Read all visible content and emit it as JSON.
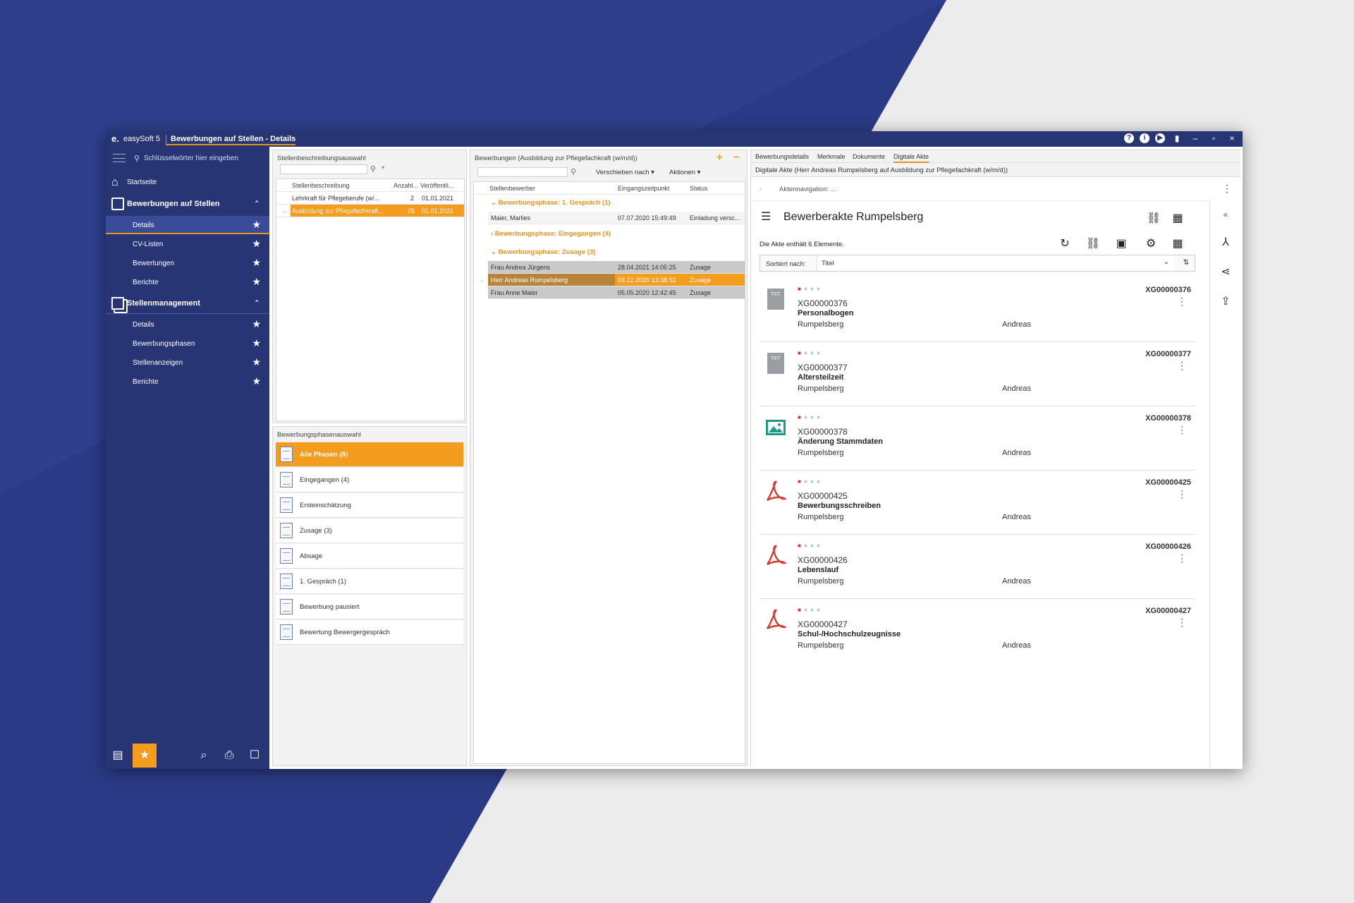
{
  "window": {
    "app_name": "easySoft 5",
    "title": "Bewerbungen auf Stellen - Details",
    "controls": [
      "?",
      "i",
      "▶",
      "signal",
      "–",
      "▭",
      "×"
    ]
  },
  "sidebar": {
    "search_placeholder": "Schlüsselwörter hier eingeben",
    "start": "Startseite",
    "group1": {
      "label": "Bewerbungen auf Stellen",
      "items": [
        "Details",
        "CV-Listen",
        "Bewertungen",
        "Berichte"
      ]
    },
    "group2": {
      "label": "Stellenmanagement",
      "items": [
        "Details",
        "Bewerbungsphasen",
        "Stellenanzeigen",
        "Berichte"
      ]
    },
    "accent": "#e8931e",
    "background": "#283575"
  },
  "stellen": {
    "title": "Stellenbeschreibungsauswahl",
    "columns": [
      "Stellenbeschreibung",
      "Anzahl...",
      "Veröffentli..."
    ],
    "rows": [
      {
        "name": "Lehrkraft für Pflegeberufe (w/...",
        "count": "2",
        "date": "01.01.2021"
      },
      {
        "name": "Ausbildung zur Pflegefachkraft...",
        "count": "25",
        "date": "01.01.2021"
      }
    ]
  },
  "phasen": {
    "title": "Bewerbungsphasenauswahl",
    "items": [
      "Alle Phasen (8)",
      "Eingegangen (4)",
      "Ersteinschätzung",
      "Zusage (3)",
      "Absage",
      "1. Gespräch (1)",
      "Bewerbung pausiert",
      "Bewertung Bewergergespräch"
    ]
  },
  "bewerbungen": {
    "title": "Bewerbungen (Ausbildung zur Pflegefachkraft (w/m/d))",
    "toolbar": {
      "move": "Verschieben nach ▾",
      "actions": "Aktionen ▾"
    },
    "columns": [
      "Stellenbewerber",
      "Eingangszeitpunkt",
      "Status"
    ],
    "groups": [
      {
        "label": "Bewerbungsphase: 1. Gespräch (1)",
        "rows": [
          {
            "name": "Maier, Marlies",
            "time": "07.07.2020 15:49:49",
            "status": "Einladung versc..."
          }
        ]
      },
      {
        "label": "Bewerbungsphase: Eingegangen (4)",
        "rows": []
      },
      {
        "label": "Bewerbungsphase: Zusage (3)",
        "rows": [
          {
            "name": "Frau Andrea Jürgens",
            "time": "28.04.2021 14:05:25",
            "status": "Zusage"
          },
          {
            "name": "Herr Andreas Rumpelsberg",
            "time": "03.12.2020 13:38:52",
            "status": "Zusage"
          },
          {
            "name": "Frau Anne Maier",
            "time": "05.05.2020 12:42:45",
            "status": "Zusage"
          }
        ]
      }
    ]
  },
  "akte": {
    "tabs": [
      "Bewerbungsdetails",
      "Merkmale",
      "Dokumente",
      "Digitale Akte"
    ],
    "subtitle": "Digitale Akte (Herr Andreas Rumpelsberg auf Ausbildung zur Pflegefachkraft (w/m/d))",
    "nav": "Aktennavigation: ...",
    "heading": "Bewerberakte Rumpelsberg",
    "count_text": "Die Akte enthält 6 Elemente.",
    "sort_label": "Sortiert nach:",
    "sort_value": "Titel",
    "docs": [
      {
        "id": "XG00000376",
        "name": "Personalbogen",
        "owner": "Rumpelsberg",
        "author": "Andreas",
        "type": "txt"
      },
      {
        "id": "XG00000377",
        "name": "Altersteilzeit",
        "owner": "Rumpelsberg",
        "author": "Andreas",
        "type": "txt"
      },
      {
        "id": "XG00000378",
        "name": "Änderung Stammdaten",
        "owner": "Rumpelsberg",
        "author": "Andreas",
        "type": "img"
      },
      {
        "id": "XG00000425",
        "name": "Bewerbungsschreiben",
        "owner": "Rumpelsberg",
        "author": "Andreas",
        "type": "pdf"
      },
      {
        "id": "XG00000426",
        "name": "Lebenslauf",
        "owner": "Rumpelsberg",
        "author": "Andreas",
        "type": "pdf"
      },
      {
        "id": "XG00000427",
        "name": "Schul-/Hochschulzeugnisse",
        "owner": "Rumpelsberg",
        "author": "Andreas",
        "type": "pdf"
      }
    ]
  }
}
